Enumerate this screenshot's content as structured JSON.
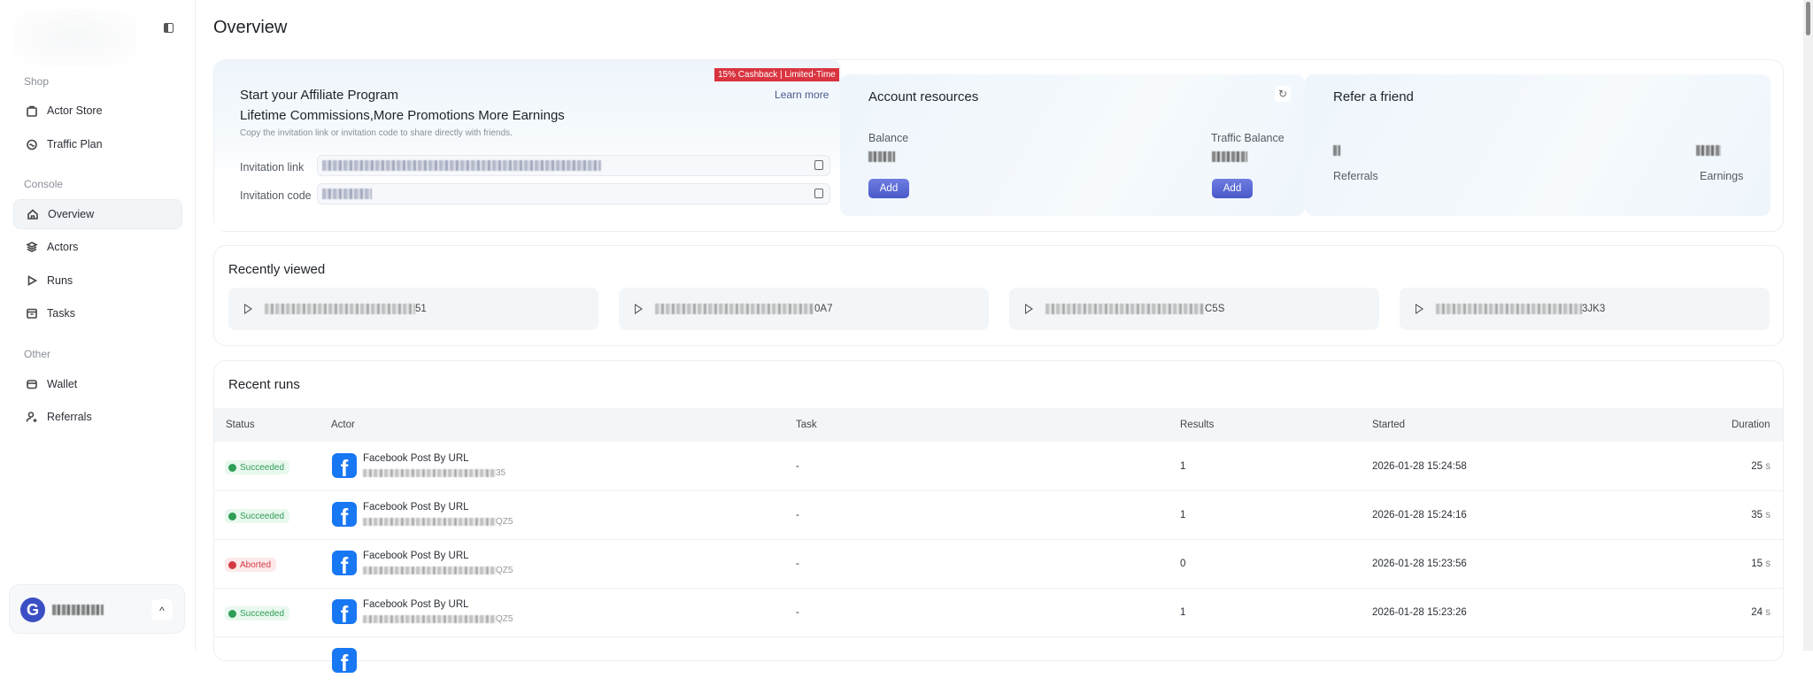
{
  "sidebar": {
    "sections": {
      "shop": "Shop",
      "console": "Console",
      "other": "Other"
    },
    "items": [
      {
        "label": "Actor Store",
        "icon": "shopping-bag-icon"
      },
      {
        "label": "Traffic Plan",
        "icon": "traffic-icon"
      },
      {
        "label": "Overview",
        "icon": "home-icon",
        "active": true
      },
      {
        "label": "Actors",
        "icon": "layers-icon"
      },
      {
        "label": "Runs",
        "icon": "play-icon"
      },
      {
        "label": "Tasks",
        "icon": "archive-icon"
      },
      {
        "label": "Wallet",
        "icon": "wallet-icon"
      },
      {
        "label": "Referrals",
        "icon": "user-plus-icon"
      }
    ]
  },
  "page": {
    "title": "Overview"
  },
  "affiliate": {
    "badge": "15% Cashback | Limited-Time",
    "learn_more": "Learn more",
    "title": "Start your Affiliate Program",
    "subtitle": "Lifetime Commissions,More Promotions More Earnings",
    "caption": "Copy the invitation link or invitation code to share directly with friends.",
    "link_label": "Invitation link",
    "code_label": "Invitation code"
  },
  "account": {
    "title": "Account resources",
    "balance_label": "Balance",
    "traffic_label": "Traffic Balance",
    "add": "Add"
  },
  "refer": {
    "title": "Refer a friend",
    "referrals_label": "Referrals",
    "earnings_label": "Earnings"
  },
  "recent": {
    "title": "Recently viewed",
    "items": [
      {
        "suffix": "51"
      },
      {
        "suffix": "0A7"
      },
      {
        "suffix": "C5S"
      },
      {
        "suffix": "3JK3"
      }
    ]
  },
  "runs": {
    "title": "Recent runs",
    "columns": [
      "Status",
      "Actor",
      "Task",
      "Results",
      "Started",
      "Duration"
    ],
    "rows": [
      {
        "status": "Succeeded",
        "actor": "Facebook Post By URL",
        "id_suffix": "35",
        "task": "-",
        "results": "1",
        "started": "2026-01-28 15:24:58",
        "duration": "25",
        "unit": "s"
      },
      {
        "status": "Succeeded",
        "actor": "Facebook Post By URL",
        "id_suffix": "QZ5",
        "task": "-",
        "results": "1",
        "started": "2026-01-28 15:24:16",
        "duration": "35",
        "unit": "s"
      },
      {
        "status": "Aborted",
        "actor": "Facebook Post By URL",
        "id_suffix": "QZ5",
        "task": "-",
        "results": "0",
        "started": "2026-01-28 15:23:56",
        "duration": "15",
        "unit": "s"
      },
      {
        "status": "Succeeded",
        "actor": "Facebook Post By URL",
        "id_suffix": "QZ5",
        "task": "-",
        "results": "1",
        "started": "2026-01-28 15:23:26",
        "duration": "24",
        "unit": "s"
      }
    ]
  },
  "colors": {
    "accent": "#4f5fd0",
    "success": "#2f9e56",
    "danger": "#d33a44",
    "badge": "#d9343f"
  }
}
